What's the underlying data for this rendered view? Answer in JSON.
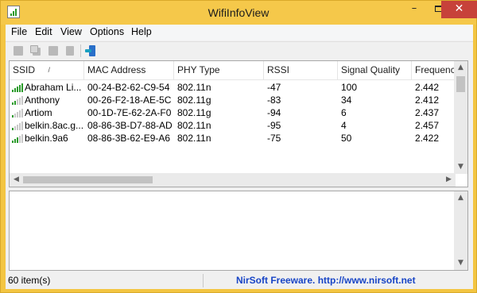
{
  "window": {
    "title": "WifiInfoView"
  },
  "titlebar_buttons": {
    "minimize": "–",
    "close": "✕"
  },
  "menu": [
    "File",
    "Edit",
    "View",
    "Options",
    "Help"
  ],
  "toolbar": [
    {
      "icon": "save-icon",
      "enabled": false
    },
    {
      "icon": "copy-icon",
      "enabled": false
    },
    {
      "icon": "html-report-icon",
      "enabled": false
    },
    {
      "icon": "properties-icon",
      "enabled": false
    },
    {
      "icon": "exit-icon",
      "enabled": true
    }
  ],
  "table": {
    "columns": [
      "SSID",
      "MAC Address",
      "PHY Type",
      "RSSI",
      "Signal Quality",
      "Frequency"
    ],
    "sorted_column": "SSID",
    "sort_indicator": "/",
    "rows": [
      {
        "ssid": "Abraham Li...",
        "mac": "00-24-B2-62-C9-54",
        "phy": "802.11n",
        "rssi": "-47",
        "quality": "100",
        "freq": "2.442",
        "bars": 5
      },
      {
        "ssid": "Anthony",
        "mac": "00-26-F2-18-AE-5C",
        "phy": "802.11g",
        "rssi": "-83",
        "quality": "34",
        "freq": "2.412",
        "bars": 2
      },
      {
        "ssid": "Artiom",
        "mac": "00-1D-7E-62-2A-F0",
        "phy": "802.11g",
        "rssi": "-94",
        "quality": "6",
        "freq": "2.437",
        "bars": 1
      },
      {
        "ssid": "belkin.8ac.g...",
        "mac": "08-86-3B-D7-88-AD",
        "phy": "802.11n",
        "rssi": "-95",
        "quality": "4",
        "freq": "2.457",
        "bars": 1
      },
      {
        "ssid": "belkin.9a6",
        "mac": "08-86-3B-62-E9-A6",
        "phy": "802.11n",
        "rssi": "-75",
        "quality": "50",
        "freq": "2.422",
        "bars": 3
      }
    ]
  },
  "status": {
    "items": "60 item(s)",
    "credit": "NirSoft Freeware.  http://www.nirsoft.net"
  },
  "colors": {
    "title_bar": "#f5c84a",
    "accent_link": "#1845c6",
    "signal_green": "#2a9b2a"
  }
}
